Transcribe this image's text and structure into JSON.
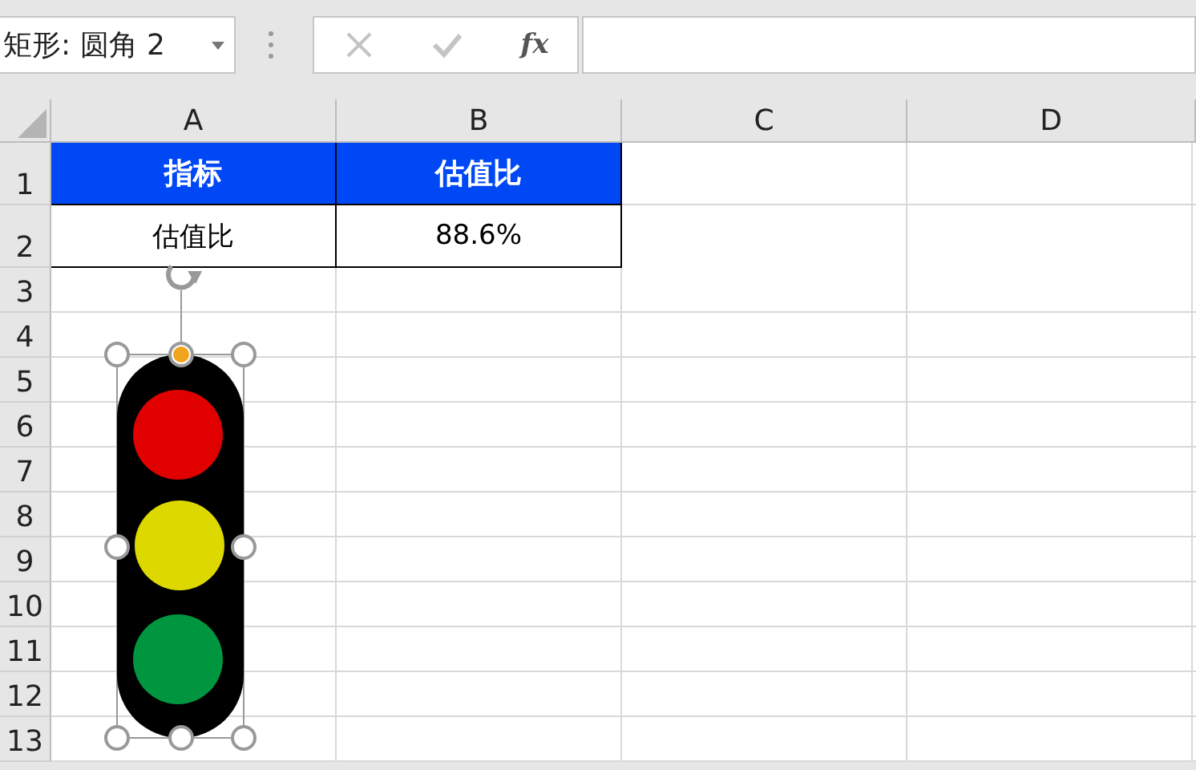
{
  "name_box": {
    "value": "矩形: 圆角 2"
  },
  "formula_bar": {
    "function_label": "fx"
  },
  "sheet": {
    "columns": [
      "A",
      "B",
      "C",
      "D"
    ],
    "rows": [
      "1",
      "2",
      "3",
      "4",
      "5",
      "6",
      "7",
      "8",
      "9",
      "10",
      "11",
      "12",
      "13"
    ],
    "table": {
      "header": [
        "指标",
        "估值比"
      ],
      "rows": [
        [
          "估值比",
          "88.6%"
        ]
      ]
    }
  }
}
